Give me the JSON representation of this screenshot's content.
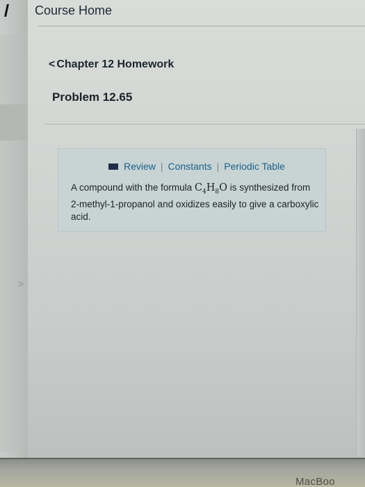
{
  "header": {
    "course_home": "Course Home"
  },
  "nav": {
    "chapter_link": "Chapter 12 Homework",
    "chevron": "<"
  },
  "problem": {
    "title": "Problem 12.65"
  },
  "resources": {
    "review": "Review",
    "separator": "|",
    "constants": "Constants",
    "periodic_table": "Periodic Table"
  },
  "question": {
    "text_before": "A compound with the formula ",
    "formula": {
      "c": "C",
      "c_sub": "4",
      "h": "H",
      "h_sub": "8",
      "o": "O"
    },
    "text_after": " is synthesized from 2-methyl-1-propanol and oxidizes easily to give a carboxylic acid."
  },
  "sidebar": {
    "chevron": ">"
  },
  "device": {
    "label": "MacBoo"
  },
  "colors": {
    "link": "#1d5f8a",
    "info_box": "#c7d4d3"
  }
}
